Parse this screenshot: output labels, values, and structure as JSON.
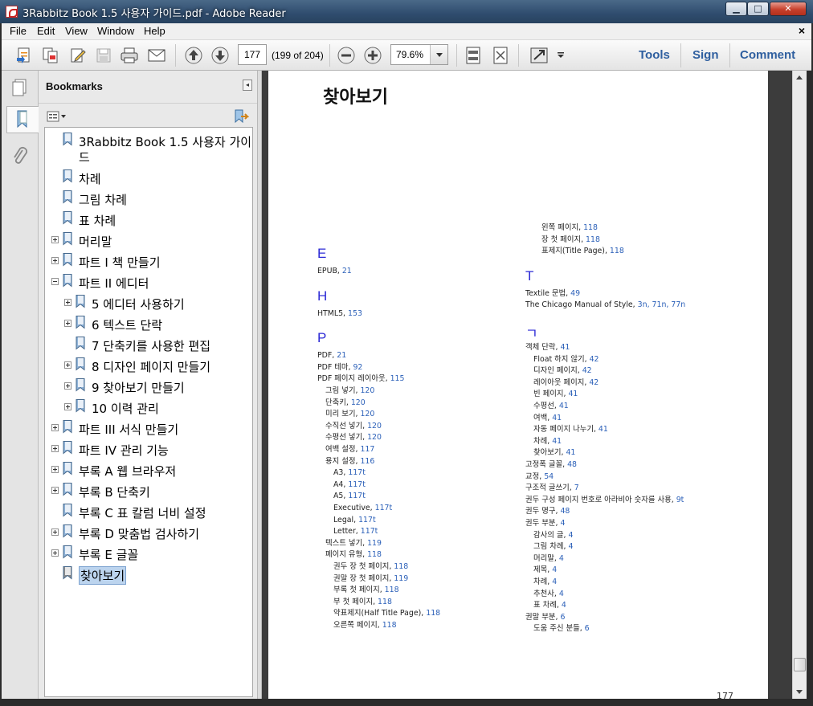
{
  "window": {
    "title": "3Rabbitz Book 1.5 사용자 가이드.pdf - Adobe Reader"
  },
  "menu": [
    "File",
    "Edit",
    "View",
    "Window",
    "Help"
  ],
  "toolbar": {
    "page_input": "177",
    "page_count": "(199 of 204)",
    "zoom": "79.6%",
    "tools_label": "Tools",
    "sign_label": "Sign",
    "comment_label": "Comment"
  },
  "panel": {
    "title": "Bookmarks"
  },
  "bookmarks": [
    {
      "label": "3Rabbitz Book 1.5 사용자 가이",
      "label2": "드",
      "expander": "none",
      "level": 0
    },
    {
      "label": "차례",
      "expander": "none",
      "level": 0
    },
    {
      "label": "그림 차례",
      "expander": "none",
      "level": 0
    },
    {
      "label": "표 차례",
      "expander": "none",
      "level": 0
    },
    {
      "label": "머리말",
      "expander": "plus",
      "level": 0
    },
    {
      "label": "파트 I 책 만들기",
      "expander": "plus",
      "level": 0
    },
    {
      "label": "파트 II 에디터",
      "expander": "minus",
      "level": 0
    },
    {
      "label": "5 에디터 사용하기",
      "expander": "plus",
      "level": 1
    },
    {
      "label": "6 텍스트 단락",
      "expander": "plus",
      "level": 1
    },
    {
      "label": "7 단축키를 사용한 편집",
      "expander": "none",
      "level": 1
    },
    {
      "label": "8 디자인 페이지 만들기",
      "expander": "plus",
      "level": 1
    },
    {
      "label": "9 찾아보기 만들기",
      "expander": "plus",
      "level": 1
    },
    {
      "label": "10 이력 관리",
      "expander": "plus",
      "level": 1
    },
    {
      "label": "파트 III 서식 만들기",
      "expander": "plus",
      "level": 0
    },
    {
      "label": "파트 IV 관리 기능",
      "expander": "plus",
      "level": 0
    },
    {
      "label": "부록 A 웹 브라우저",
      "expander": "plus",
      "level": 0
    },
    {
      "label": "부록 B 단축키",
      "expander": "plus",
      "level": 0
    },
    {
      "label": "부록 C 표 칼럼 너비 설정",
      "expander": "none",
      "level": 0
    },
    {
      "label": "부록 D 맞춤법 검사하기",
      "expander": "plus",
      "level": 0
    },
    {
      "label": "부록 E 글꼴",
      "expander": "plus",
      "level": 0
    },
    {
      "label": "찾아보기",
      "expander": "none",
      "level": 0,
      "selected": true
    }
  ],
  "doc": {
    "title": "찾아보기",
    "page_number": "177",
    "left_column": [
      {
        "type": "head",
        "text": "E"
      },
      {
        "type": "entry",
        "indent": 0,
        "text": "EPUB, ",
        "pages": "21"
      },
      {
        "type": "head",
        "text": "H"
      },
      {
        "type": "entry",
        "indent": 0,
        "text": "HTML5, ",
        "pages": "153"
      },
      {
        "type": "head",
        "text": "P"
      },
      {
        "type": "entry",
        "indent": 0,
        "text": "PDF, ",
        "pages": "21"
      },
      {
        "type": "entry",
        "indent": 0,
        "text": "PDF 테마, ",
        "pages": "92"
      },
      {
        "type": "entry",
        "indent": 0,
        "text": "PDF 페이지 레이아웃, ",
        "pages": "115"
      },
      {
        "type": "entry",
        "indent": 1,
        "text": "그림 넣기, ",
        "pages": "120"
      },
      {
        "type": "entry",
        "indent": 1,
        "text": "단축키, ",
        "pages": "120"
      },
      {
        "type": "entry",
        "indent": 1,
        "text": "미리 보기, ",
        "pages": "120"
      },
      {
        "type": "entry",
        "indent": 1,
        "text": "수직선 넣기, ",
        "pages": "120"
      },
      {
        "type": "entry",
        "indent": 1,
        "text": "수평선 넣기, ",
        "pages": "120"
      },
      {
        "type": "entry",
        "indent": 1,
        "text": "여백 설정, ",
        "pages": "117"
      },
      {
        "type": "entry",
        "indent": 1,
        "text": "용지 설정, ",
        "pages": "116"
      },
      {
        "type": "entry",
        "indent": 2,
        "text": "A3, ",
        "pages": "117t"
      },
      {
        "type": "entry",
        "indent": 2,
        "text": "A4, ",
        "pages": "117t"
      },
      {
        "type": "entry",
        "indent": 2,
        "text": "A5, ",
        "pages": "117t"
      },
      {
        "type": "entry",
        "indent": 2,
        "text": "Executive, ",
        "pages": "117t"
      },
      {
        "type": "entry",
        "indent": 2,
        "text": "Legal, ",
        "pages": "117t"
      },
      {
        "type": "entry",
        "indent": 2,
        "text": "Letter, ",
        "pages": "117t"
      },
      {
        "type": "entry",
        "indent": 1,
        "text": "텍스트 넣기, ",
        "pages": "119"
      },
      {
        "type": "entry",
        "indent": 1,
        "text": "페이지 유형, ",
        "pages": "118"
      },
      {
        "type": "entry",
        "indent": 2,
        "text": "권두 장 첫 페이지, ",
        "pages": "118"
      },
      {
        "type": "entry",
        "indent": 2,
        "text": "권말 장 첫 페이지, ",
        "pages": "119"
      },
      {
        "type": "entry",
        "indent": 2,
        "text": "부록 첫 페이지, ",
        "pages": "118"
      },
      {
        "type": "entry",
        "indent": 2,
        "text": "부 첫 페이지, ",
        "pages": "118"
      },
      {
        "type": "entry",
        "indent": 2,
        "text": "약표제지(Half Title Page), ",
        "pages": "118"
      },
      {
        "type": "entry",
        "indent": 2,
        "text": "오른쪽 페이지, ",
        "pages": "118"
      }
    ],
    "right_column": [
      {
        "type": "entry",
        "indent": 2,
        "text": "왼쪽 페이지, ",
        "pages": "118"
      },
      {
        "type": "entry",
        "indent": 2,
        "text": "장 첫 페이지, ",
        "pages": "118"
      },
      {
        "type": "entry",
        "indent": 2,
        "text": "표제지(Title Page), ",
        "pages": "118"
      },
      {
        "type": "head",
        "text": "T"
      },
      {
        "type": "entry",
        "indent": 0,
        "text": "Textile 문법, ",
        "pages": "49"
      },
      {
        "type": "entry",
        "indent": 0,
        "text": "The Chicago Manual of Style, ",
        "pages": "3n, 71n, 77n"
      },
      {
        "type": "head",
        "text": "ㄱ"
      },
      {
        "type": "entry",
        "indent": 0,
        "text": "객체 단락, ",
        "pages": "41"
      },
      {
        "type": "entry",
        "indent": 1,
        "text": "Float 하지 않기, ",
        "pages": "42"
      },
      {
        "type": "entry",
        "indent": 1,
        "text": "디자인 페이지, ",
        "pages": "42"
      },
      {
        "type": "entry",
        "indent": 1,
        "text": "레이아웃 페이지, ",
        "pages": "42"
      },
      {
        "type": "entry",
        "indent": 1,
        "text": "빈 페이지, ",
        "pages": "41"
      },
      {
        "type": "entry",
        "indent": 1,
        "text": "수평선, ",
        "pages": "41"
      },
      {
        "type": "entry",
        "indent": 1,
        "text": "여백, ",
        "pages": "41"
      },
      {
        "type": "entry",
        "indent": 1,
        "text": "자동 페이지 나누기, ",
        "pages": "41"
      },
      {
        "type": "entry",
        "indent": 1,
        "text": "차례, ",
        "pages": "41"
      },
      {
        "type": "entry",
        "indent": 1,
        "text": "찾아보기, ",
        "pages": "41"
      },
      {
        "type": "entry",
        "indent": 0,
        "text": "고정폭 글꼴, ",
        "pages": "48"
      },
      {
        "type": "entry",
        "indent": 0,
        "text": "교정, ",
        "pages": "54"
      },
      {
        "type": "entry",
        "indent": 0,
        "text": "구조적 글쓰기, ",
        "pages": "7"
      },
      {
        "type": "entry",
        "indent": 0,
        "text": "권두 구성 페이지 번호로 아라비아 숫자를 사용, ",
        "pages": "9t"
      },
      {
        "type": "entry",
        "indent": 0,
        "text": "권두 명구, ",
        "pages": "48"
      },
      {
        "type": "entry",
        "indent": 0,
        "text": "권두 부분, ",
        "pages": "4"
      },
      {
        "type": "entry",
        "indent": 1,
        "text": "감사의 글, ",
        "pages": "4"
      },
      {
        "type": "entry",
        "indent": 1,
        "text": "그림 차례, ",
        "pages": "4"
      },
      {
        "type": "entry",
        "indent": 1,
        "text": "머리말, ",
        "pages": "4"
      },
      {
        "type": "entry",
        "indent": 1,
        "text": "제목, ",
        "pages": "4"
      },
      {
        "type": "entry",
        "indent": 1,
        "text": "차례, ",
        "pages": "4"
      },
      {
        "type": "entry",
        "indent": 1,
        "text": "추천사, ",
        "pages": "4"
      },
      {
        "type": "entry",
        "indent": 1,
        "text": "표 차례, ",
        "pages": "4"
      },
      {
        "type": "entry",
        "indent": 0,
        "text": "권말 부분, ",
        "pages": "6"
      },
      {
        "type": "entry",
        "indent": 1,
        "text": "도움 주신 분들, ",
        "pages": "6"
      }
    ]
  }
}
